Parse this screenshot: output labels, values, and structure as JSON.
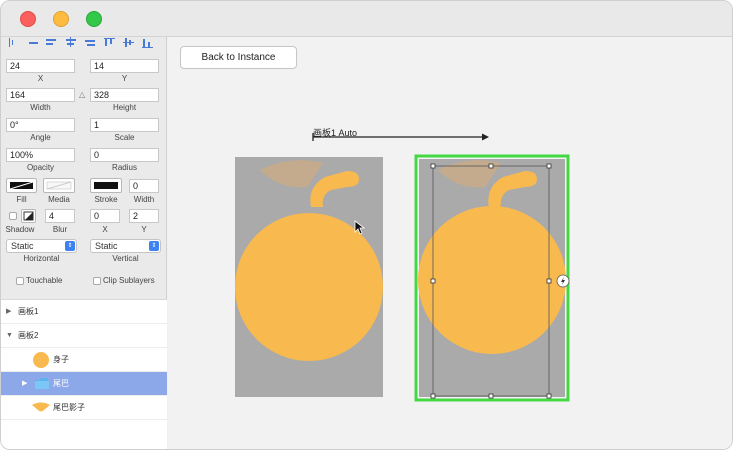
{
  "window": {
    "traffic_lights": {
      "close": "#fc605c",
      "minimize": "#fdbc40",
      "zoom": "#34c84a"
    }
  },
  "inspector": {
    "x": {
      "value": "24",
      "label": "X"
    },
    "y": {
      "value": "14",
      "label": "Y"
    },
    "width": {
      "value": "164",
      "label": "Width"
    },
    "height": {
      "value": "328",
      "label": "Height"
    },
    "angle": {
      "value": "0°",
      "label": "Angle"
    },
    "scale": {
      "value": "1",
      "label": "Scale"
    },
    "opacity": {
      "value": "100%",
      "label": "Opacity"
    },
    "radius": {
      "value": "0",
      "label": "Radius"
    },
    "fill_label": "Fill",
    "media_label": "Media",
    "stroke_label": "Stroke",
    "stroke_width": {
      "value": "0",
      "label": "Width"
    },
    "shadow_label": "Shadow",
    "blur": {
      "value": "4",
      "label": "Blur"
    },
    "shadow_x": {
      "value": "0",
      "label": "X"
    },
    "shadow_y": {
      "value": "2",
      "label": "Y"
    },
    "horizontal": {
      "value": "Static",
      "label": "Horizontal"
    },
    "vertical": {
      "value": "Static",
      "label": "Vertical"
    },
    "touchable_label": "Touchable",
    "clip_label": "Clip Sublayers"
  },
  "layers": [
    {
      "name": "画板1",
      "expanded": false
    },
    {
      "name": "画板2",
      "expanded": true
    },
    {
      "name": "身子",
      "icon": "circle-layer-icon"
    },
    {
      "name": "尾巴",
      "icon": "folder-icon",
      "selected": true
    },
    {
      "name": "尾巴影子",
      "icon": "shadow-layer-icon"
    }
  ],
  "canvas": {
    "back_button": "Back to Instance",
    "transition_label": "画板1 Auto",
    "accent_selection": "#44d944",
    "fruit_color": "#f8b94f",
    "artboard_bg": "#aaaaaa"
  }
}
